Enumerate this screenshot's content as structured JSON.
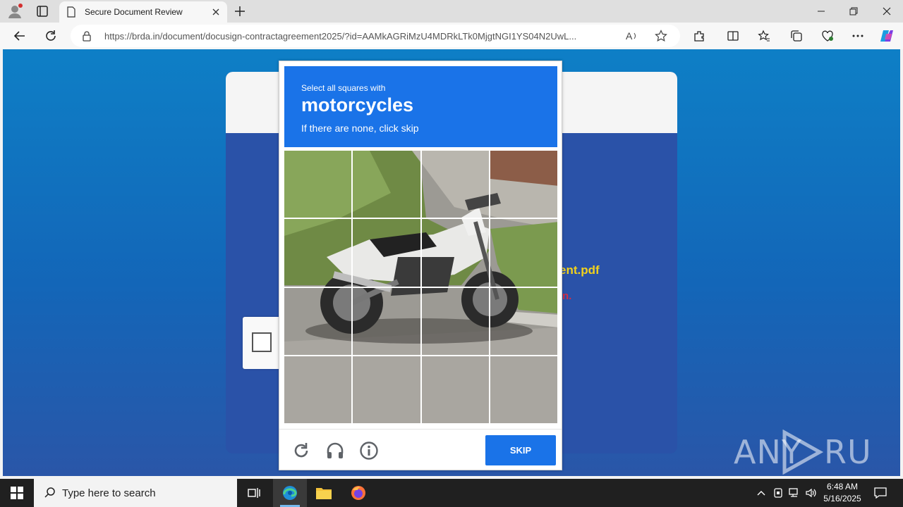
{
  "browser": {
    "tab_title": "Secure Document Review",
    "url": "https://brda.in/document/docusign-contractagreement2025/?id=AAMkAGRiMzU4MDRkLTk0MjgtNGI1YS04N2UwL..."
  },
  "page": {
    "partial_filename": "ent.pdf",
    "partial_red_text": "n."
  },
  "captcha": {
    "instruction_line1": "Select all squares with",
    "target": "motorcycles",
    "instruction_line3": "If there are none, click skip",
    "skip_label": "SKIP",
    "tile_count": 16
  },
  "watermark": {
    "text": "ANY RUN"
  },
  "taskbar": {
    "search_placeholder": "Type here to search",
    "time": "6:48 AM",
    "date": "5/16/2025"
  },
  "colors": {
    "captcha_blue": "#1a73e8",
    "page_gradient_top": "#0e7fc6",
    "page_gradient_bottom": "#2a56a8",
    "filename_yellow": "#f2d21b",
    "red_text": "#d52f44"
  }
}
